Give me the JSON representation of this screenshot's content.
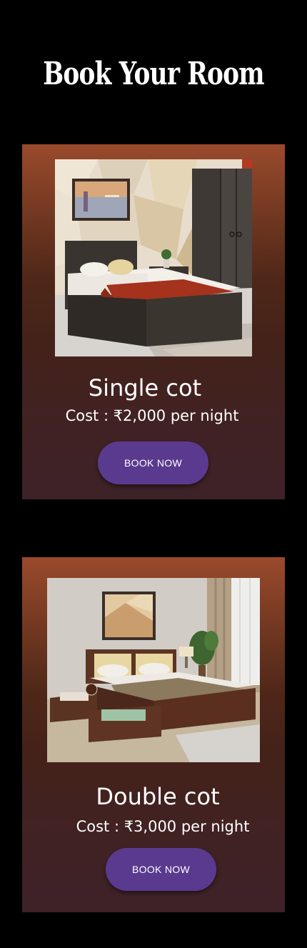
{
  "header": {
    "title": "Book Your Room"
  },
  "rooms": [
    {
      "name": "Single cot",
      "cost": "Cost : ₹2,000 per night",
      "button_label": "BOOK NOW",
      "image": "single-bed-room-photo"
    },
    {
      "name": "Double cot",
      "cost": "Cost : ₹3,000 per night",
      "button_label": "BOOK NOW",
      "image": "double-bed-room-photo"
    }
  ],
  "colors": {
    "background": "#000000",
    "card_top": "#9a4a2c",
    "card_bottom": "#3d2228",
    "button": "#5a3a8e",
    "text": "#ffffff"
  }
}
